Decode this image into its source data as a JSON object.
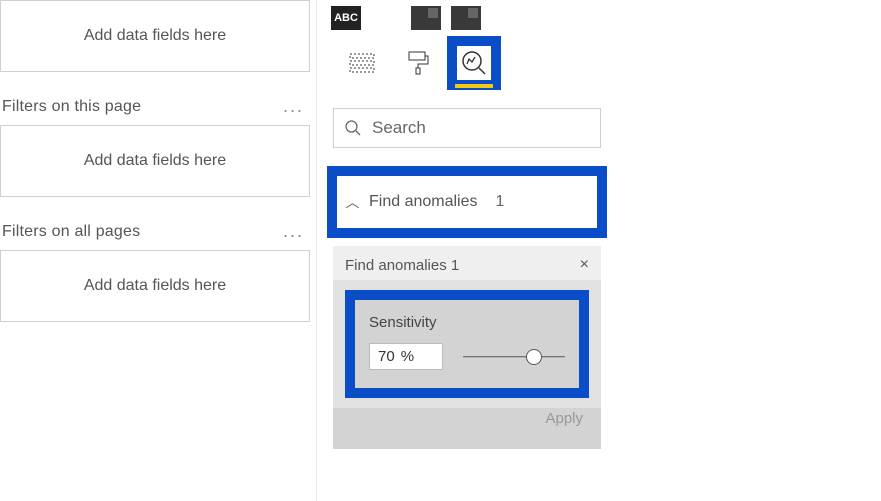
{
  "filters": {
    "well_placeholder": "Add data fields here",
    "section_page": "Filters on this page",
    "section_all": "Filters on all pages",
    "ellipsis": "..."
  },
  "viz": {
    "search_placeholder": "Search",
    "anomalies_label": "Find anomalies",
    "anomalies_count": "1",
    "card_title": "Find anomalies 1",
    "close": "×",
    "sensitivity_label": "Sensitivity",
    "sensitivity_value": "70",
    "percent_symbol": "%",
    "slider_pct": 70,
    "apply_label": "Apply"
  }
}
